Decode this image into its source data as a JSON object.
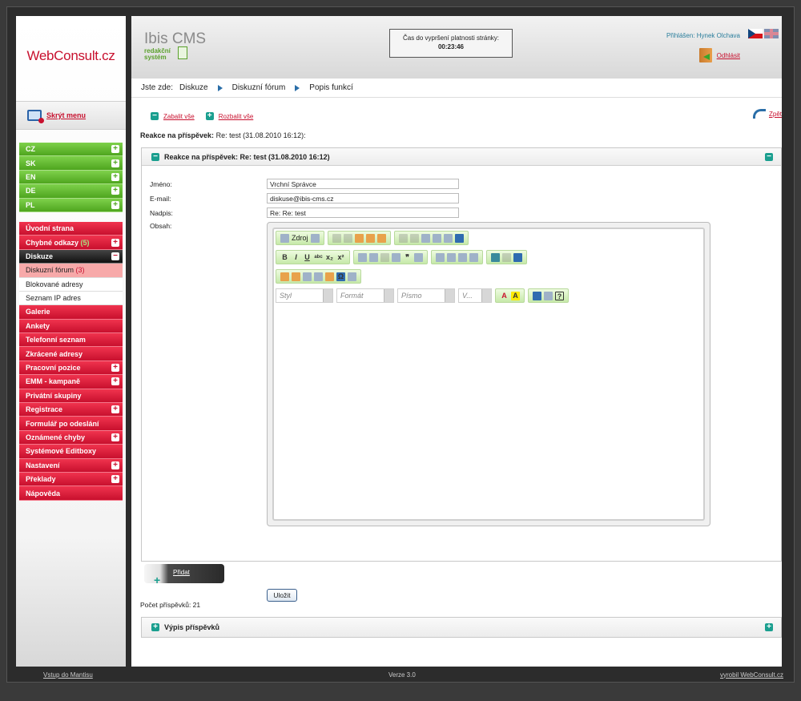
{
  "logo": "WebConsult.cz",
  "hide_menu": "Skrýt menu",
  "langs": [
    {
      "label": "CZ"
    },
    {
      "label": "SK"
    },
    {
      "label": "EN"
    },
    {
      "label": "DE"
    },
    {
      "label": "PL"
    }
  ],
  "menu": [
    {
      "label": "Úvodní strana",
      "type": "red",
      "toggle": ""
    },
    {
      "label": "Chybné odkazy",
      "count": "(5)",
      "type": "red",
      "toggle": "+"
    },
    {
      "label": "Diskuze",
      "type": "black",
      "toggle": "−"
    },
    {
      "label": "Diskuzní fórum",
      "count": "(3)",
      "type": "sub active",
      "toggle": ""
    },
    {
      "label": "Blokované adresy",
      "type": "sub",
      "toggle": ""
    },
    {
      "label": "Seznam IP adres",
      "type": "sub",
      "toggle": ""
    },
    {
      "label": "Galerie",
      "type": "red",
      "toggle": ""
    },
    {
      "label": "Ankety",
      "type": "red",
      "toggle": ""
    },
    {
      "label": "Telefonní seznam",
      "type": "red",
      "toggle": ""
    },
    {
      "label": "Zkrácené adresy",
      "type": "red",
      "toggle": ""
    },
    {
      "label": "Pracovní pozice",
      "type": "red",
      "toggle": "+"
    },
    {
      "label": "EMM - kampaně",
      "type": "red",
      "toggle": "+"
    },
    {
      "label": "Privátní skupiny",
      "type": "red",
      "toggle": ""
    },
    {
      "label": "Registrace",
      "type": "red",
      "toggle": "+"
    },
    {
      "label": "Formulář po odeslání",
      "type": "red",
      "toggle": ""
    },
    {
      "label": "Oznámené chyby",
      "type": "red",
      "toggle": "+"
    },
    {
      "label": "Systémové Editboxy",
      "type": "red",
      "toggle": ""
    },
    {
      "label": "Nastavení",
      "type": "red",
      "toggle": "+"
    },
    {
      "label": "Překlady",
      "type": "red",
      "toggle": "+"
    },
    {
      "label": "Nápověda",
      "type": "red",
      "toggle": ""
    }
  ],
  "header": {
    "product": "Ibis CMS",
    "product_sub1": "redakční",
    "product_sub2": "systém",
    "timer_label": "Čas do vypršení platnosti stránky:",
    "timer_value": "00:23:46",
    "user": "Přihlášen: Hynek Olchava",
    "logout": "Odhlásit"
  },
  "breadcrumb": {
    "prefix": "Jste zde:",
    "items": [
      "Diskuze",
      "Diskuzní fórum",
      "Popis funkcí"
    ]
  },
  "actions": {
    "collapse_all": "Zabalit vše",
    "expand_all": "Rozbalit vše",
    "back": "Zpět"
  },
  "reply": {
    "label_bold": "Reakce na příspěvek:",
    "label_rest": " Re: test (31.08.2010 16:12):",
    "panel_title": "Reakce na příspěvek: Re: test (31.08.2010 16:12)"
  },
  "form": {
    "name_label": "Jméno:",
    "name_value": "Vrchní Správce",
    "email_label": "E-mail:",
    "email_value": "diskuse@ibis-cms.cz",
    "title_label": "Nadpis:",
    "title_value": "Re: Re: test",
    "content_label": "Obsah:"
  },
  "editor": {
    "source": "Zdroj",
    "style": "Styl",
    "format": "Formát",
    "font": "Písmo",
    "size": "V..."
  },
  "save": "Uložit",
  "add": "Přidat",
  "posts_count": "Počet příspěvků: 21",
  "posts_list": "Výpis příspěvků",
  "footer": {
    "left": "Vstup do Mantisu",
    "center": "Verze 3.0",
    "right": "vyrobil WebConsult.cz"
  }
}
